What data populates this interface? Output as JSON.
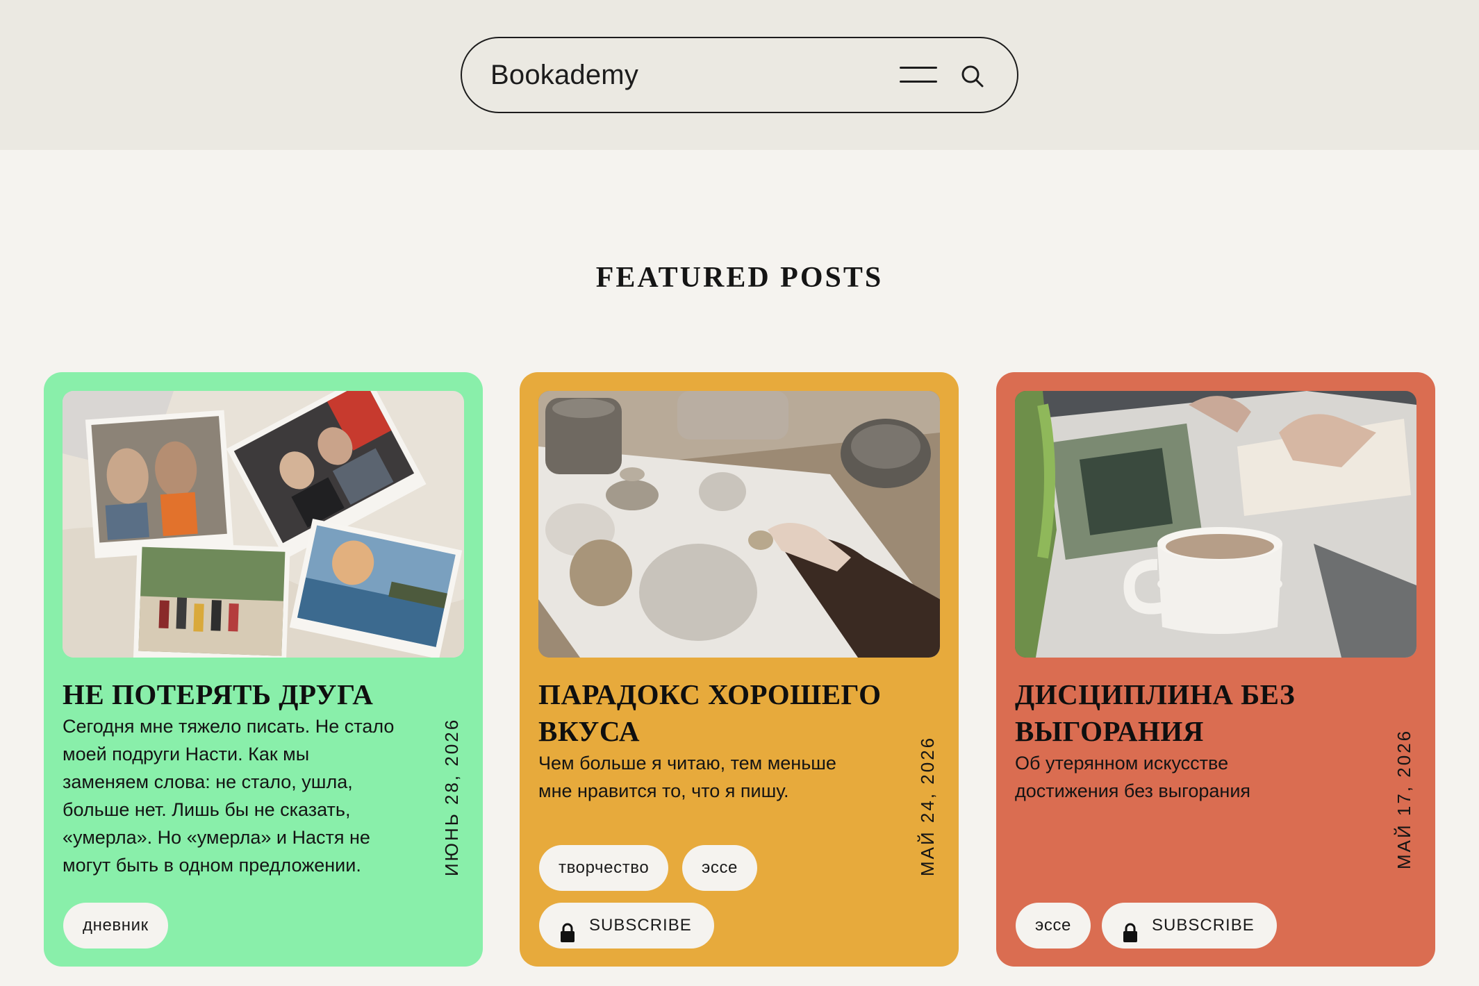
{
  "header": {
    "brand": "Bookademy",
    "menu_icon": "hamburger-menu-icon",
    "search_icon": "search-icon"
  },
  "featured": {
    "title": "FEATURED POSTS"
  },
  "cards": [
    {
      "bg_color": "#89efaa",
      "title": "НЕ ПОТЕРЯТЬ ДРУГА",
      "excerpt": "Сегодня мне тяжело писать. Не стало моей подруги Насти. Как мы заменяем слова: не стало, ушла, больше нет. Лишь бы не сказать, «умерла». Но «умерла» и Настя не могут быть в одном предложении.",
      "date": "ИЮНЬ 28, 2026",
      "tags": [
        "дневник"
      ],
      "image": "photos-on-bedsheet"
    },
    {
      "bg_color": "#e7aa3c",
      "title": "ПАРАДОКС ХОРОШЕГО ВКУСА",
      "excerpt": "Чем больше я читаю, тем меньше мне нравится то, что я пишу.",
      "date": "МАЙ 24, 2026",
      "tags": [
        "творчество",
        "эссе"
      ],
      "subscribe_label": "SUBSCRIBE",
      "image": "stones-and-pottery"
    },
    {
      "bg_color": "#da6d51",
      "title": "ДИСЦИПЛИНА БЕЗ ВЫГОРАНИЯ",
      "excerpt": "Об утерянном искусстве достижения без выгорания",
      "date": "МАЙ 17, 2026",
      "tags": [
        "эссе"
      ],
      "subscribe_label": "SUBSCRIBE",
      "image": "coffee-and-notebook"
    }
  ]
}
